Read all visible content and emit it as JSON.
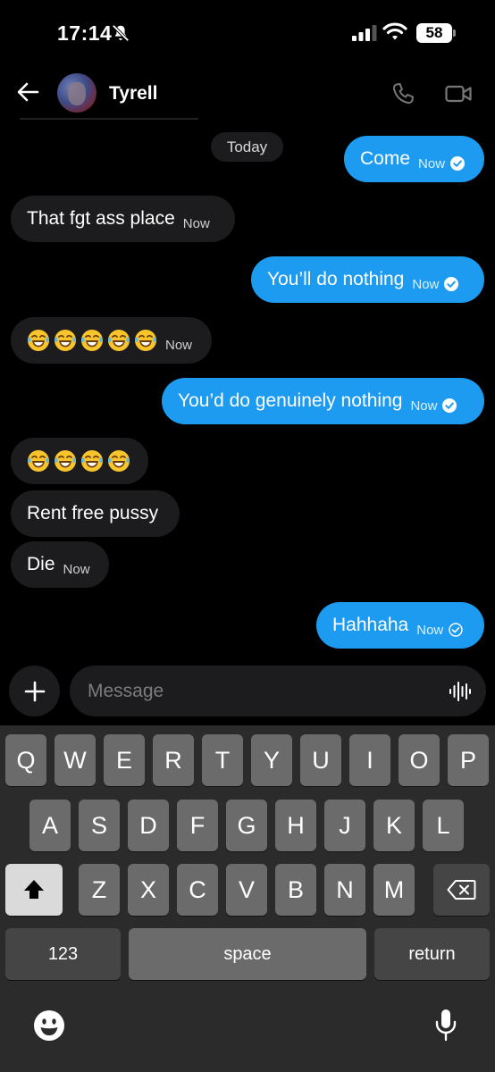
{
  "status": {
    "time": "17:14",
    "battery": "58"
  },
  "header": {
    "contact_name": "Tyrell"
  },
  "date_separator": "Today",
  "messages": [
    {
      "dir": "out",
      "text": "Come",
      "time": "Now",
      "status": "read"
    },
    {
      "dir": "in",
      "text": "That fgt ass place",
      "time": "Now"
    },
    {
      "dir": "out",
      "text": "You’ll do nothing",
      "time": "Now",
      "status": "read"
    },
    {
      "dir": "in",
      "text": "😂😂😂😂😂",
      "time": "Now"
    },
    {
      "dir": "out",
      "text": "You’d do genuinely nothing",
      "time": "Now",
      "status": "read"
    },
    {
      "dir": "in",
      "text": "😂😂😂😂",
      "time": ""
    },
    {
      "dir": "in",
      "text": "Rent free pussy",
      "time": ""
    },
    {
      "dir": "in",
      "text": "Die",
      "time": "Now"
    },
    {
      "dir": "out",
      "text": "Hahhaha",
      "time": "Now",
      "status": "sent"
    }
  ],
  "composer": {
    "placeholder": "Message"
  },
  "keyboard": {
    "row1": [
      "Q",
      "W",
      "E",
      "R",
      "T",
      "Y",
      "U",
      "I",
      "O",
      "P"
    ],
    "row2": [
      "A",
      "S",
      "D",
      "F",
      "G",
      "H",
      "J",
      "K",
      "L"
    ],
    "row3": [
      "Z",
      "X",
      "C",
      "V",
      "B",
      "N",
      "M"
    ],
    "numbers_label": "123",
    "space_label": "space",
    "return_label": "return"
  },
  "colors": {
    "outgoing_bubble": "#1d9bf0",
    "incoming_bubble": "#1c1c1e",
    "background": "#000000"
  },
  "icons": [
    "back-arrow-icon",
    "phone-icon",
    "video-camera-icon",
    "bell-slash-icon",
    "plus-icon",
    "voice-wave-icon",
    "shift-icon",
    "backspace-icon",
    "emoji-icon",
    "microphone-icon",
    "read-check-icon",
    "sent-check-icon"
  ]
}
